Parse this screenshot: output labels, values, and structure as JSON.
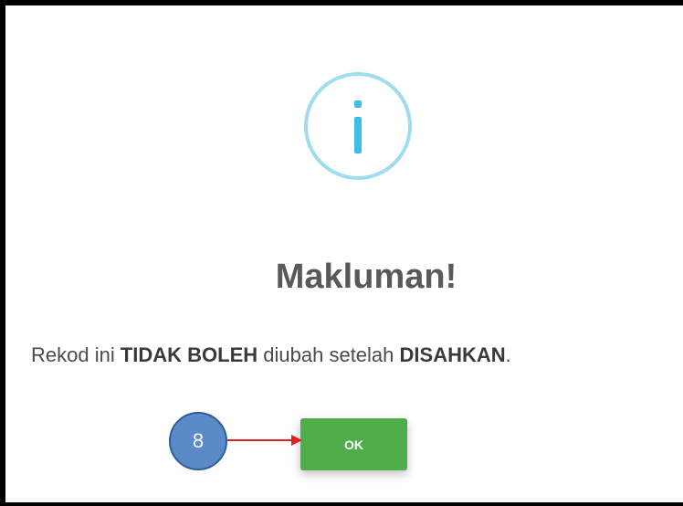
{
  "dialog": {
    "title": "Makluman!",
    "message_parts": [
      "Rekod ini ",
      "TIDAK BOLEH",
      " diubah setelah ",
      "DISAHKAN",
      "."
    ],
    "ok_label": "OK",
    "icon": "info-icon",
    "icon_color": "#3dbde8",
    "ok_color": "#4fae4a"
  },
  "annotation": {
    "step_number": "8",
    "badge_color": "#5b8ac8",
    "arrow_color": "#e02020"
  }
}
